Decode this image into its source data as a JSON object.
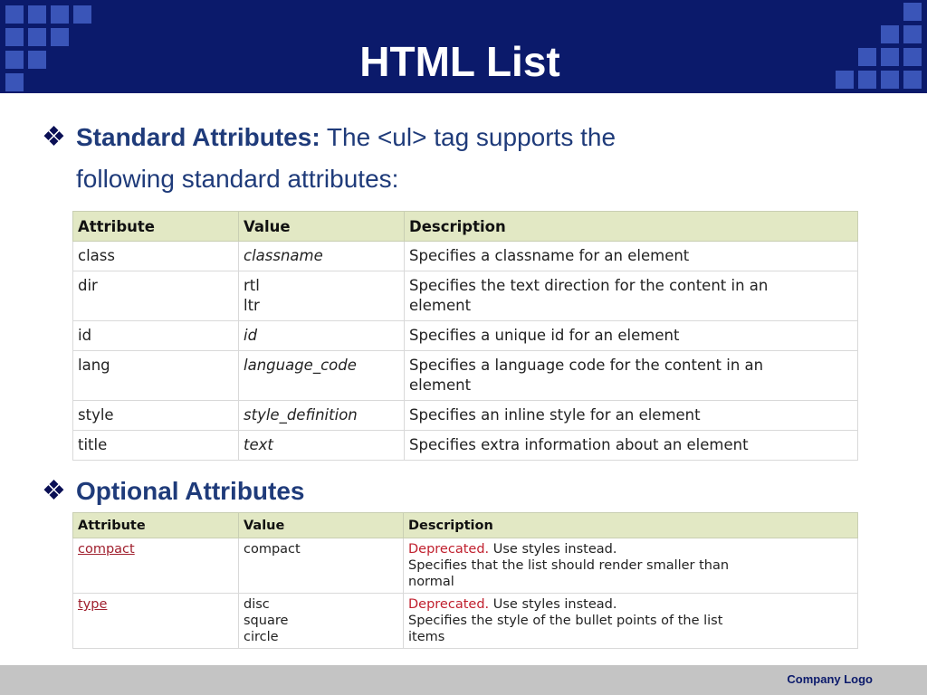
{
  "slide": {
    "title": "HTML List"
  },
  "standard": {
    "label": "Standard Attributes:",
    "text_line1": " The <ul> tag supports the",
    "text_line2": "following standard attributes:",
    "bullet_icon": "diamond-bullet-icon",
    "headers": [
      "Attribute",
      "Value",
      "Description"
    ],
    "rows": [
      {
        "attr": "class",
        "value": [
          "classname"
        ],
        "italic": true,
        "desc": [
          "Specifies a classname for an element"
        ]
      },
      {
        "attr": "dir",
        "value": [
          "rtl",
          "ltr"
        ],
        "italic": false,
        "desc": [
          "Specifies the text direction for the content in an",
          "element"
        ]
      },
      {
        "attr": "id",
        "value": [
          "id"
        ],
        "italic": true,
        "desc": [
          "Specifies a unique id for an element"
        ]
      },
      {
        "attr": "lang",
        "value": [
          "language_code"
        ],
        "italic": true,
        "desc": [
          "Specifies a language code for the content in an",
          "element"
        ]
      },
      {
        "attr": "style",
        "value": [
          "style_definition"
        ],
        "italic": true,
        "desc": [
          "Specifies an inline style for an element"
        ]
      },
      {
        "attr": "title",
        "value": [
          "text"
        ],
        "italic": true,
        "desc": [
          "Specifies extra information about an element"
        ]
      }
    ]
  },
  "optional": {
    "label": "Optional Attributes",
    "bullet_icon": "diamond-bullet-icon",
    "headers": [
      "Attribute",
      "Value",
      "Description"
    ],
    "rows": [
      {
        "attr": "compact",
        "value": [
          "compact"
        ],
        "deprecated": "Deprecated.",
        "desc_first": " Use styles instead.",
        "desc": [
          "Specifies that the list should render smaller than",
          "normal"
        ]
      },
      {
        "attr": "type",
        "value": [
          "disc",
          "square",
          "circle"
        ],
        "deprecated": "Deprecated.",
        "desc_first": " Use styles instead.",
        "desc": [
          "Specifies the style of the bullet points of the list",
          "items"
        ]
      }
    ]
  },
  "footer": {
    "company": "Company  Logo"
  },
  "colors": {
    "header_bg": "#0b1a6b",
    "square": "#3a55b8",
    "table_header": "#e2e8c4",
    "deprecated_red": "#c0202e",
    "footer_bg": "#c4c4c4"
  }
}
